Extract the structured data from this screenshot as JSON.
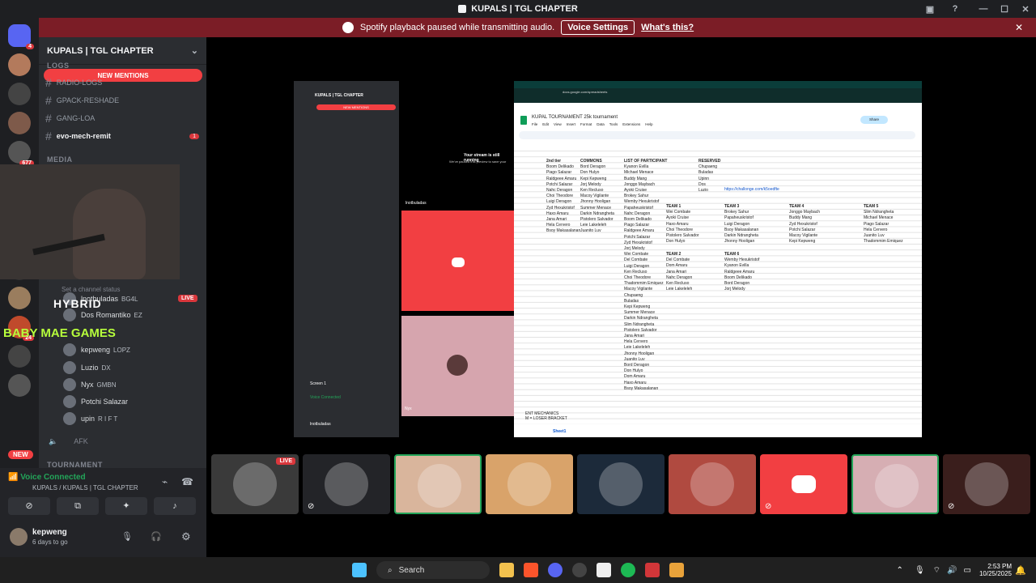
{
  "window": {
    "title": "KUPALS | TGL CHAPTER"
  },
  "banner": {
    "text": "Spotify playback paused while transmitting audio.",
    "button": "Voice Settings",
    "link": "What's this?"
  },
  "server_list": [
    {
      "badge": "4",
      "color": "#5865f2"
    },
    {
      "badge": "",
      "color": "#b37a5c"
    },
    {
      "badge": "",
      "color": "#444"
    },
    {
      "badge": "",
      "color": "#7e5a4a"
    },
    {
      "badge": "677",
      "color": "#555"
    },
    {
      "badge": "",
      "color": "#884444"
    },
    {
      "badge": "",
      "color": "#666"
    },
    {
      "badge": "",
      "color": "#888"
    },
    {
      "badge": "",
      "color": "#333"
    },
    {
      "badge": "",
      "color": "#9a7d5e"
    },
    {
      "badge": "24",
      "color": "#c04a2c"
    },
    {
      "badge": "",
      "color": "#444"
    },
    {
      "badge": "",
      "color": "#555"
    }
  ],
  "server": {
    "name": "KUPALS | TGL CHAPTER",
    "new_mentions": "NEW MENTIONS",
    "new_badge": "NEW"
  },
  "categories": {
    "logs": "LOGS",
    "media": "MEDIA",
    "tournament": "TOURNAMENT"
  },
  "channels": [
    {
      "label": "RADIO-LOGS"
    },
    {
      "label": "GPACK-RESHADE"
    },
    {
      "label": "GANG-LOA"
    },
    {
      "label": "evo-mech-remit",
      "unread": "1"
    }
  ],
  "webcam_overlay": {
    "brand": "HYBRID",
    "caption": "BABY MAE GAMES",
    "set_status": "Set a channel status"
  },
  "voice_members": [
    {
      "name": "lnotbuladas",
      "tag": "BG4L",
      "live": "LIVE"
    },
    {
      "name": "Dos Romantiko",
      "tag": "EZ"
    },
    {
      "name": "kepweng",
      "tag": "LOPZ"
    },
    {
      "name": "Luzio",
      "tag": "DX"
    },
    {
      "name": "Nyx",
      "tag": "GMBN"
    },
    {
      "name": "Potchi Salazar",
      "tag": ""
    },
    {
      "name": "upin",
      "tag": "R I F T"
    },
    {
      "name": "AFK",
      "tag": ""
    }
  ],
  "voice_connected": {
    "status": "Voice Connected",
    "channel": "KUPALS / KUPALS | TGL CHAPTER"
  },
  "user": {
    "name": "kepweng",
    "status": "6 days to go"
  },
  "stream": {
    "inner_title": "KUPALS | TGL CHAPTER",
    "notice_title": "Your stream is still running",
    "notice_body": "We've paused this preview to save your",
    "tile_user": "lnotbuladas",
    "tile_user2": "Nyx",
    "inner_new_mentions": "NEW MENTIONS",
    "inner_voice_connected": "Voice Connected",
    "inner_screen": "Screen 1",
    "inner_user": "lnotbuladas"
  },
  "sheet": {
    "doc_title": "KUPAL TOURNAMENT 25k tournament",
    "menu": [
      "File",
      "Edit",
      "View",
      "Insert",
      "Format",
      "Data",
      "Tools",
      "Extensions",
      "Help"
    ],
    "url": "docs.google.com/spreadsheets",
    "headers": [
      "2nd tier",
      "COMMONS",
      "LIST OF PARTICIPANT",
      "RESERVED"
    ],
    "tier2": [
      "Boom Delikado",
      "Piago Salazar",
      "Raldgeee Amaru",
      "Potchi Salazar",
      "Nahc Deragon",
      "Choi Theodore",
      "Luigi Deragon",
      "Zyd Hexukristof",
      "Haxo Amaru",
      "Jana Amari",
      "Hela Cervero",
      "Bsoy Makasalanan"
    ],
    "commons": [
      "Bord Deragon",
      "Don Hulyo",
      "Kepi Kepweng",
      "Jorj Melody",
      "Ken Recluso",
      "Macoy Vigilante",
      "Jhonny Hooligan",
      "Summer Menace",
      "Darkin Ndrangheta",
      "Pistolero Salvador",
      "Leie Lakeleleh",
      "Juanito Luv"
    ],
    "participants": [
      "Kyanon Evilla",
      "Michael Menace",
      "Buddy Mang",
      "Jonggo Maybach",
      "Ayoki Cruise",
      "Brokey Sahur",
      "Wemby Hexukristof",
      "Papaheuskristof",
      "Nahc Deragon",
      "Boom Delikado",
      "Piago Salazar",
      "Raldgeee Amaru",
      "Potchi Salazar",
      "Zyd Hexukristof",
      "Jorj Melody",
      "Wei Combate",
      "Del Combate",
      "Luigi Deragon",
      "Ken Recluso",
      "Choi Theodore",
      "Thadommim Emiquez",
      "Macoy Vigilante",
      "Chupaeng",
      "Buladas",
      "Kepi Kepweng",
      "Summer Menace",
      "Darkin Ndrangheta",
      "Slim Ndrangheta",
      "Pistolero Salvador",
      "Jana Amari",
      "Hela Cervero",
      "Leie Lakeleleh",
      "Jhonny Hooligan",
      "Juanito Luv",
      "Bord Deragon",
      "Don Hulyo",
      "Dom Amaru",
      "Haxo Amaru",
      "Bsoy Makasalanan"
    ],
    "reserved": [
      "Chupaeng",
      "Buladas",
      "Upinn",
      "Dos",
      "Luzio"
    ],
    "link": "https://challonge.com/k5oedfte",
    "teams": [
      {
        "name": "TEAM 1",
        "members": [
          "Wei Combate",
          "Ayoki Cruise",
          "Haxo Amaru",
          "Choi Theodore",
          "Pistolero Salvador",
          "Don Hulyo"
        ]
      },
      {
        "name": "TEAM 2",
        "members": [
          "Del Combate",
          "Dom Amaru",
          "Jana Amari",
          "Nahc Deragon",
          "Ken Recluso",
          "Leie Lakeleleh"
        ]
      },
      {
        "name": "TEAM 3",
        "members": [
          "Brokey Sahur",
          "Papaheuskristof",
          "Luigi Deragon",
          "Bsoy Makasalanan",
          "Darkin Ndrangheta",
          "Jhonny Hooligan"
        ]
      },
      {
        "name": "TEAM 4",
        "members": [
          "Jonggo Maybach",
          "Buddy Mang",
          "Zyd Hexukristof",
          "Potchi Salazar",
          "Macoy Vigilante",
          "Kepi Kepweng"
        ]
      },
      {
        "name": "TEAM 5",
        "members": [
          "Slim Ndrangheta",
          "Michael Menace",
          "Piago Salazar",
          "Hela Cervero",
          "Juanito Luv",
          "Thadommim Emiquez"
        ]
      },
      {
        "name": "TEAM 6",
        "members": [
          "Wemby Hexukristof",
          "Kyanon Evilla",
          "Raldgeee Amaru",
          "Boom Delikado",
          "Bord Deragon",
          "Jorj Melody"
        ]
      }
    ],
    "footer_note": "ENT MECHANICS",
    "footer_note2": "M = LOSER BRACKET",
    "sheet_tab": "Sheet1"
  },
  "tiles": [
    {
      "label": "LIVE",
      "color": "#3a3a3a"
    },
    {
      "label": "",
      "color": "#232428"
    },
    {
      "label": "",
      "color": "#d9b59c"
    },
    {
      "label": "",
      "color": "#d9a36a"
    },
    {
      "label": "",
      "color": "#1c2a3a"
    },
    {
      "label": "",
      "color": "#b04a40"
    },
    {
      "label": "",
      "color": "#f23f42"
    },
    {
      "label": "",
      "color": "#d6aeb3"
    },
    {
      "label": "",
      "color": "#3a1e1c"
    }
  ],
  "taskbar": {
    "search": "Search",
    "time": "2:53 PM",
    "date": "10/25/2025"
  }
}
